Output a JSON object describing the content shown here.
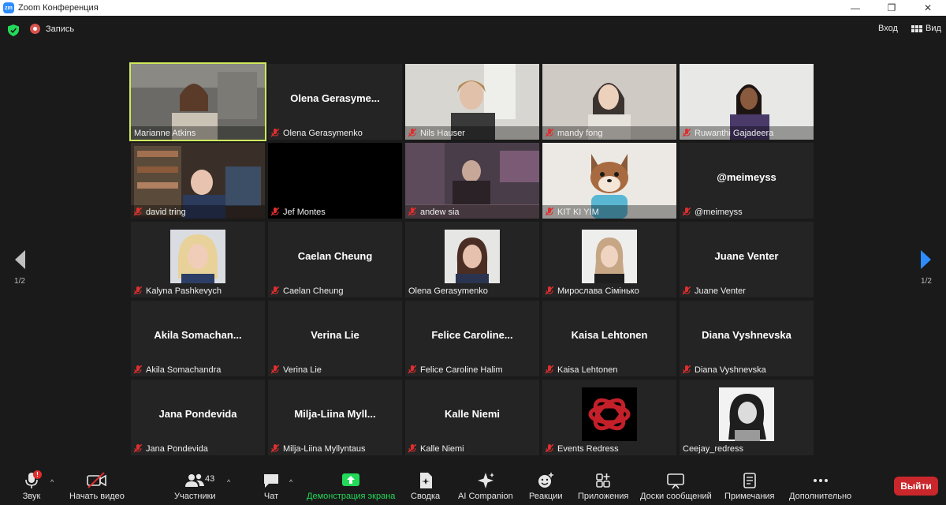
{
  "window": {
    "title": "Zoom Конференция",
    "minimize": "—",
    "maximize": "❐",
    "close": "✕"
  },
  "topbar": {
    "recording": "Запись",
    "enter": "Вход",
    "view": "Вид"
  },
  "colors": {
    "accent_green": "#23d959",
    "speaker_outline": "#cfe85a",
    "leave_red": "#c9272b",
    "muted_red": "#e02e2e",
    "nav_blue": "#2d8cff"
  },
  "participants": [
    {
      "display": "",
      "name": "Marianne Atkins"
    },
    {
      "display": "Olena  Gerasyme...",
      "name": "Olena Gerasymenko"
    },
    {
      "display": "",
      "name": "Nils Hauser"
    },
    {
      "display": "",
      "name": "mandy fong"
    },
    {
      "display": "",
      "name": "Ruwanthi Gajadeera"
    },
    {
      "display": "",
      "name": "david tring"
    },
    {
      "display": "",
      "name": "Jef Montes"
    },
    {
      "display": "",
      "name": "andew sia"
    },
    {
      "display": "",
      "name": "KIT KI YIM"
    },
    {
      "display": "@meimeyss",
      "name": "@meimeyss"
    },
    {
      "display": "",
      "name": "Kalyna Pashkevych"
    },
    {
      "display": "Caelan Cheung",
      "name": "Caelan Cheung"
    },
    {
      "display": "",
      "name": "Olena Gerasymenko"
    },
    {
      "display": "",
      "name": "Мирослава Сімінько"
    },
    {
      "display": "Juane Venter",
      "name": "Juane Venter"
    },
    {
      "display": "Akila  Somachan...",
      "name": "Akila Somachandra"
    },
    {
      "display": "Verina Lie",
      "name": "Verina Lie"
    },
    {
      "display": "Felice  Caroline...",
      "name": "Felice Caroline Halim"
    },
    {
      "display": "Kaisa Lehtonen",
      "name": "Kaisa Lehtonen"
    },
    {
      "display": "Diana Vyshnevska",
      "name": "Diana Vyshnevska"
    },
    {
      "display": "Jana Pondevida",
      "name": "Jana Pondevida"
    },
    {
      "display": "Milja-Liina  Myll...",
      "name": "Milja-Liina Myllyntaus"
    },
    {
      "display": "Kalle Niemi",
      "name": "Kalle Niemi"
    },
    {
      "display": "",
      "name": "Events Redress"
    },
    {
      "display": "",
      "name": "Ceejay_redress"
    }
  ],
  "pagination": {
    "left": "1/2",
    "right": "1/2"
  },
  "toolbar": {
    "audio": "Звук",
    "audio_badge": "!",
    "video": "Начать видео",
    "participants": "Участники",
    "participants_count": "43",
    "chat": "Чат",
    "share": "Демонстрация экрана",
    "summary": "Сводка",
    "ai": "AI Companion",
    "reactions": "Реакции",
    "apps": "Приложения",
    "whiteboards": "Доски сообщений",
    "notes": "Примечания",
    "more": "Дополнительно",
    "leave": "Выйти"
  }
}
